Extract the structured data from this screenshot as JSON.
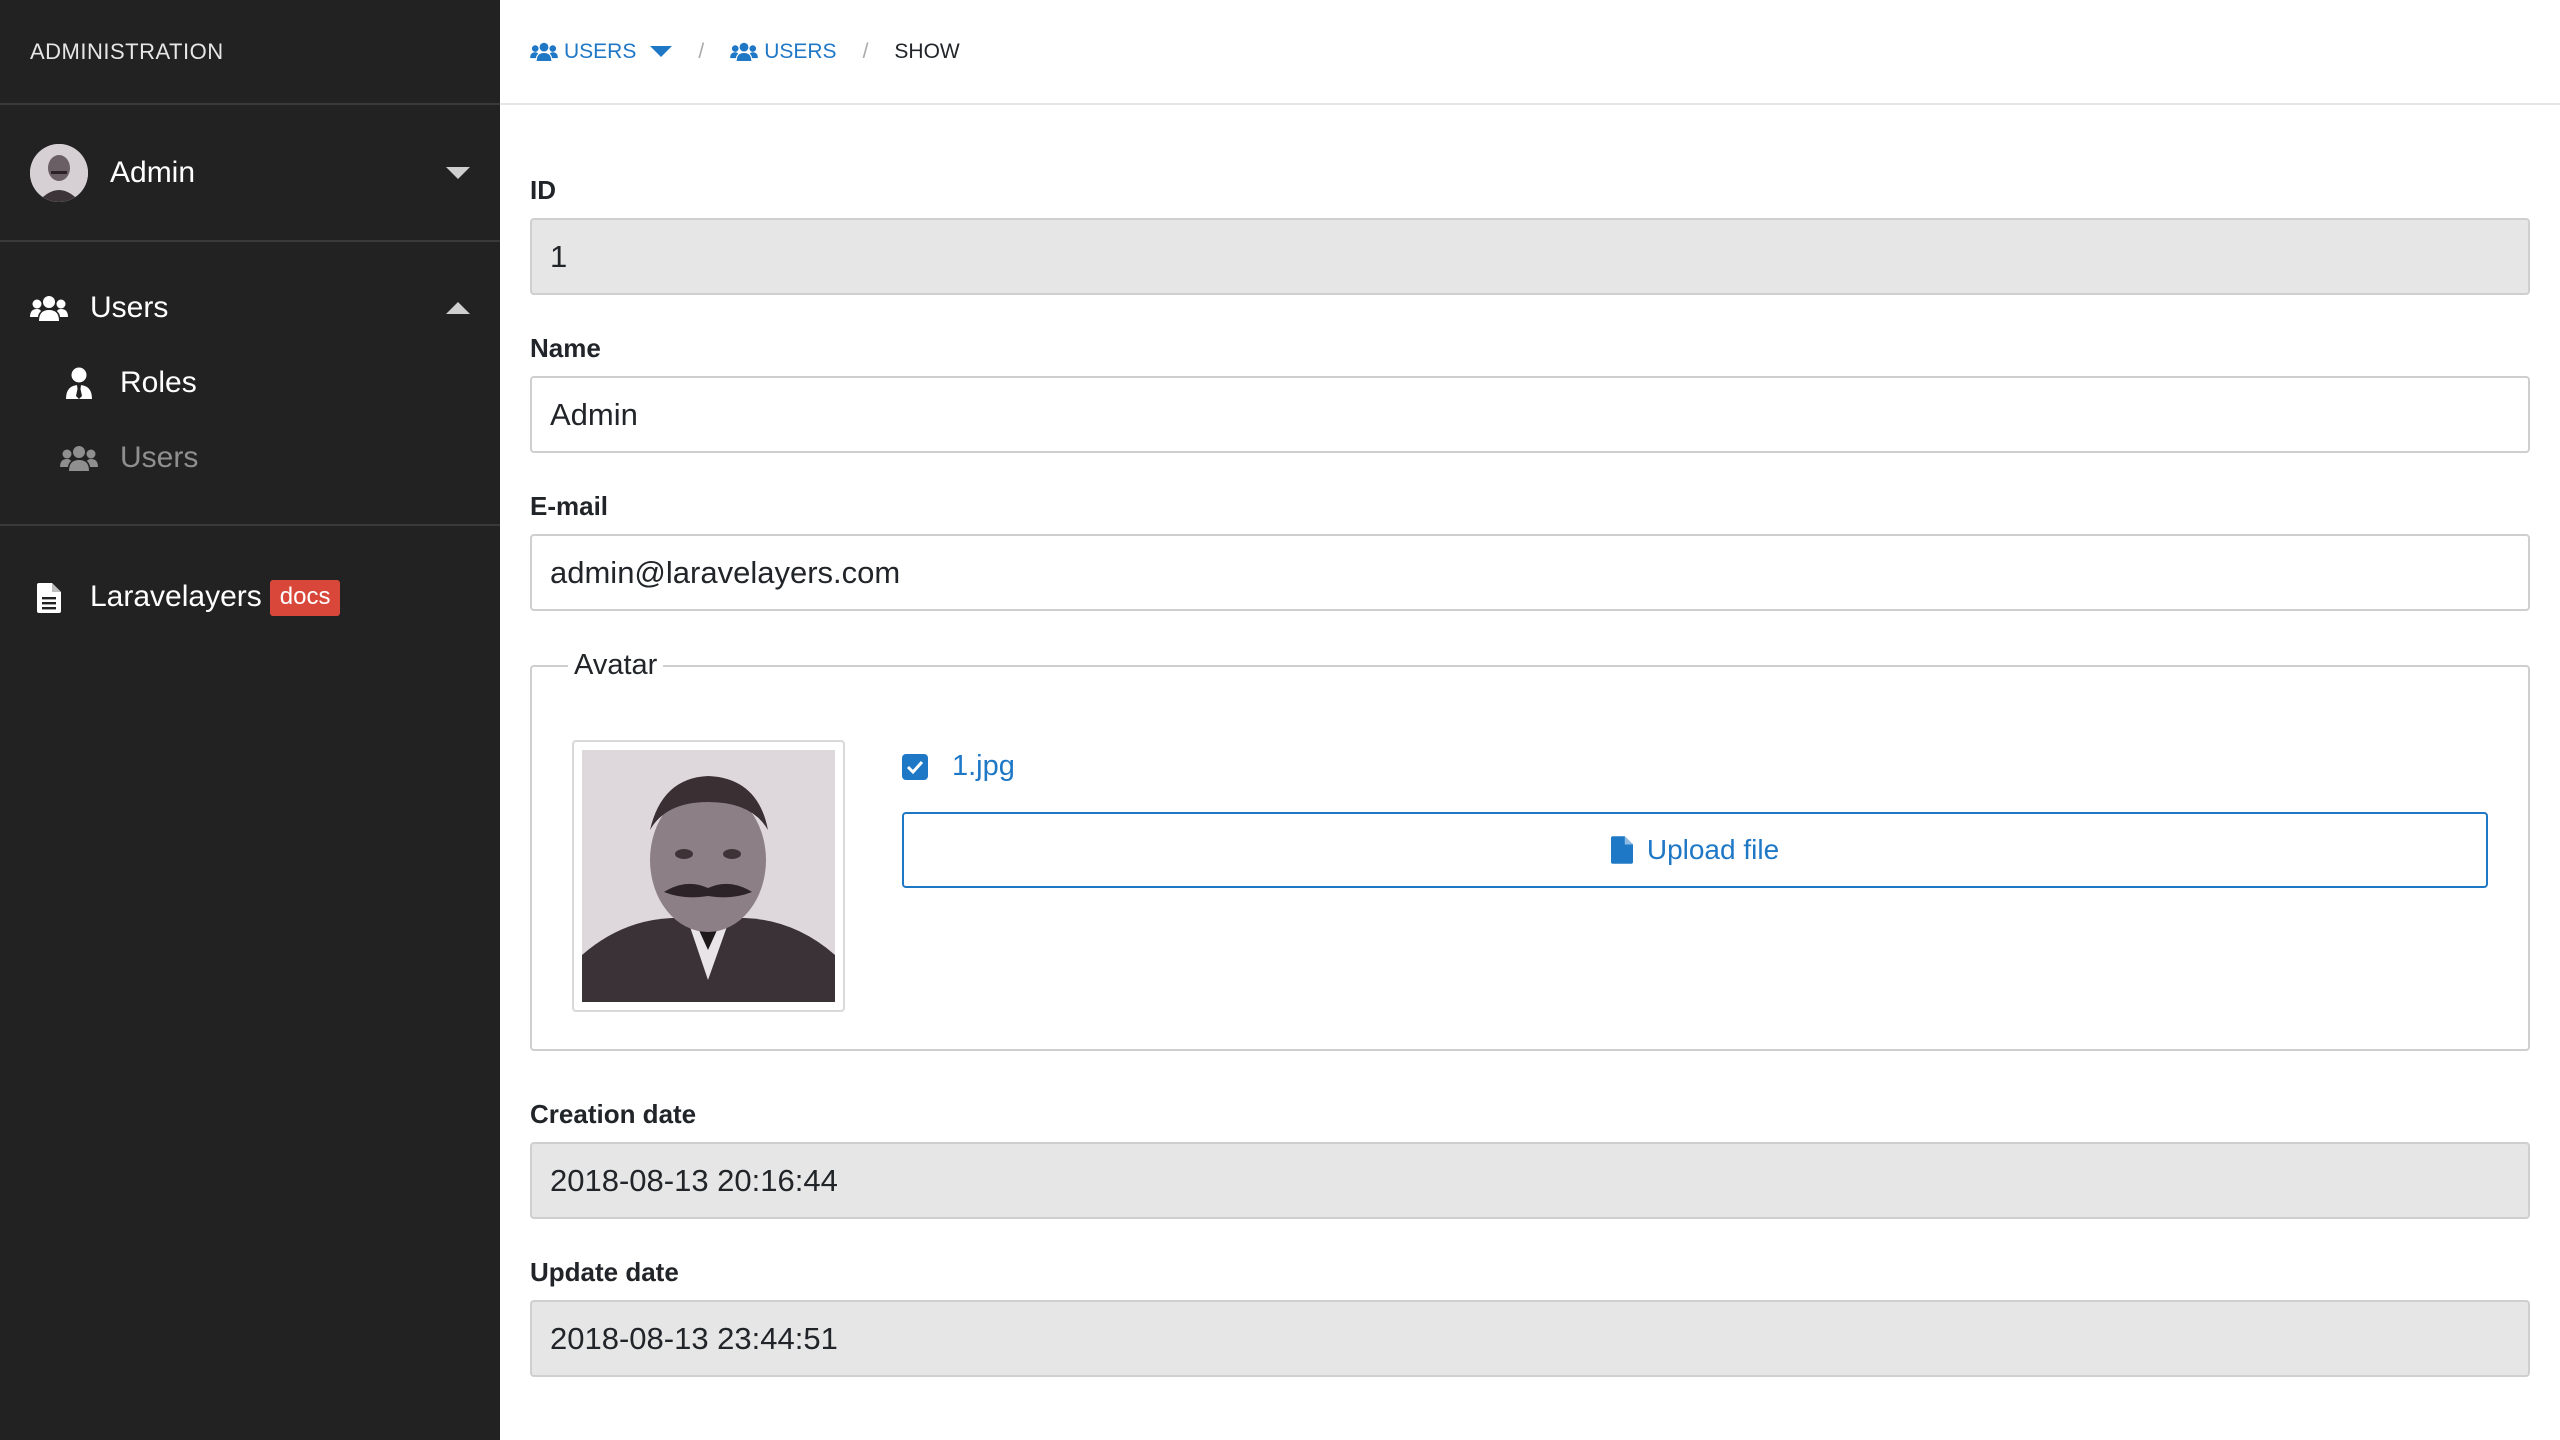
{
  "sidebar": {
    "title": "ADMINISTRATION",
    "user": {
      "name": "Admin"
    },
    "nav": {
      "users_group": "Users",
      "roles": "Roles",
      "users": "Users"
    },
    "docs": {
      "label": "Laravelayers",
      "badge": "docs"
    },
    "colors": {
      "background": "#222222",
      "badge": "#d9463a"
    }
  },
  "breadcrumb": {
    "items": [
      "USERS",
      "USERS",
      "SHOW"
    ],
    "separator": "/"
  },
  "form": {
    "id": {
      "label": "ID",
      "value": "1"
    },
    "name": {
      "label": "Name",
      "value": "Admin"
    },
    "email": {
      "label": "E-mail",
      "value": "admin@laravelayers.com"
    },
    "avatar": {
      "legend": "Avatar",
      "file_name": "1.jpg",
      "checked": true,
      "upload_label": "Upload file"
    },
    "created": {
      "label": "Creation date",
      "value": "2018-08-13 20:16:44"
    },
    "updated": {
      "label": "Update date",
      "value": "2018-08-13 23:44:51"
    }
  },
  "colors": {
    "accent": "#1f78c6",
    "readonly_bg": "#e6e6e6"
  },
  "icons": [
    "users-icon",
    "user-tie-icon",
    "file-icon",
    "caret-down-icon",
    "caret-up-icon",
    "check-icon"
  ]
}
